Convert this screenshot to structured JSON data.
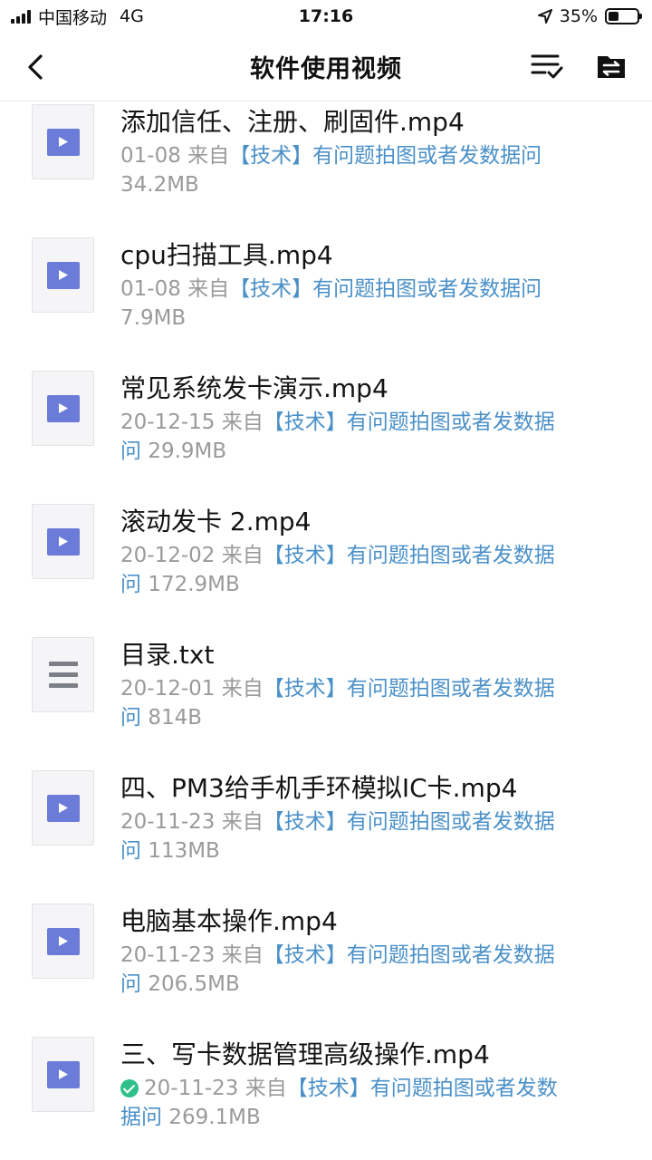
{
  "status_bar": {
    "carrier": "中国移动",
    "network": "4G",
    "time": "17:16",
    "battery": "35%",
    "battery_level": 0.35
  },
  "header": {
    "title": "软件使用视频",
    "icons": [
      "back-icon",
      "sort-check-icon",
      "folder-transfer-icon"
    ]
  },
  "files": [
    {
      "name": "添加信任、注册、刷固件.mp4",
      "date": "01-08",
      "from": "来自",
      "source": "【技术】有问题拍图或者发数据问",
      "size": "34.2MB",
      "type": "video",
      "downloaded": false
    },
    {
      "name": "cpu扫描工具.mp4",
      "date": "01-08",
      "from": "来自",
      "source": "【技术】有问题拍图或者发数据问",
      "size": "7.9MB",
      "type": "video",
      "downloaded": false
    },
    {
      "name": "常见系统发卡演示.mp4",
      "date": "20-12-15",
      "from": "来自",
      "source": "【技术】有问题拍图或者发数据问",
      "size": "29.9MB",
      "type": "video",
      "downloaded": false
    },
    {
      "name": "滚动发卡 2.mp4",
      "date": "20-12-02",
      "from": "来自",
      "source": "【技术】有问题拍图或者发数据问",
      "size": "172.9MB",
      "type": "video",
      "downloaded": false
    },
    {
      "name": "目录.txt",
      "date": "20-12-01",
      "from": "来自",
      "source": "【技术】有问题拍图或者发数据问",
      "size": "814B",
      "type": "text",
      "downloaded": false
    },
    {
      "name": "四、PM3给手机手环模拟IC卡.mp4",
      "date": "20-11-23",
      "from": "来自",
      "source": "【技术】有问题拍图或者发数据问",
      "size": "113MB",
      "type": "video",
      "downloaded": false
    },
    {
      "name": "电脑基本操作.mp4",
      "date": "20-11-23",
      "from": "来自",
      "source": "【技术】有问题拍图或者发数据问",
      "size": "206.5MB",
      "type": "video",
      "downloaded": false
    },
    {
      "name": "三、写卡数据管理高级操作.mp4",
      "date": "20-11-23",
      "from": "来自",
      "source": "【技术】有问题拍图或者发数据问",
      "size": "269.1MB",
      "type": "video",
      "downloaded": true
    }
  ]
}
